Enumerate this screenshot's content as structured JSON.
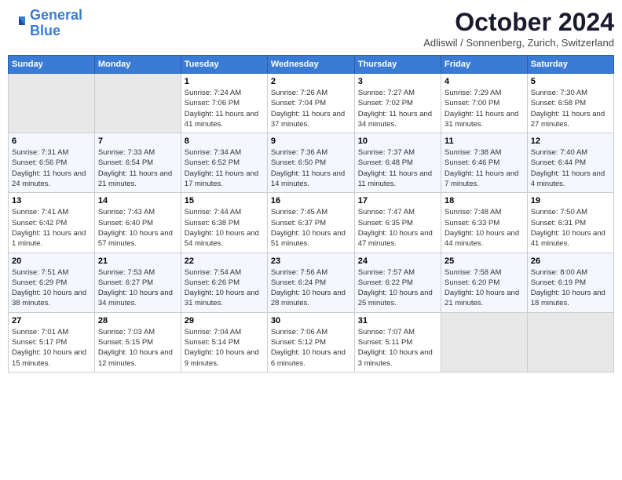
{
  "header": {
    "logo_line1": "General",
    "logo_line2": "Blue",
    "month_title": "October 2024",
    "subtitle": "Adliswil / Sonnenberg, Zurich, Switzerland"
  },
  "weekdays": [
    "Sunday",
    "Monday",
    "Tuesday",
    "Wednesday",
    "Thursday",
    "Friday",
    "Saturday"
  ],
  "weeks": [
    [
      {
        "day": "",
        "sunrise": "",
        "sunset": "",
        "daylight": ""
      },
      {
        "day": "",
        "sunrise": "",
        "sunset": "",
        "daylight": ""
      },
      {
        "day": "1",
        "sunrise": "Sunrise: 7:24 AM",
        "sunset": "Sunset: 7:06 PM",
        "daylight": "Daylight: 11 hours and 41 minutes."
      },
      {
        "day": "2",
        "sunrise": "Sunrise: 7:26 AM",
        "sunset": "Sunset: 7:04 PM",
        "daylight": "Daylight: 11 hours and 37 minutes."
      },
      {
        "day": "3",
        "sunrise": "Sunrise: 7:27 AM",
        "sunset": "Sunset: 7:02 PM",
        "daylight": "Daylight: 11 hours and 34 minutes."
      },
      {
        "day": "4",
        "sunrise": "Sunrise: 7:29 AM",
        "sunset": "Sunset: 7:00 PM",
        "daylight": "Daylight: 11 hours and 31 minutes."
      },
      {
        "day": "5",
        "sunrise": "Sunrise: 7:30 AM",
        "sunset": "Sunset: 6:58 PM",
        "daylight": "Daylight: 11 hours and 27 minutes."
      }
    ],
    [
      {
        "day": "6",
        "sunrise": "Sunrise: 7:31 AM",
        "sunset": "Sunset: 6:56 PM",
        "daylight": "Daylight: 11 hours and 24 minutes."
      },
      {
        "day": "7",
        "sunrise": "Sunrise: 7:33 AM",
        "sunset": "Sunset: 6:54 PM",
        "daylight": "Daylight: 11 hours and 21 minutes."
      },
      {
        "day": "8",
        "sunrise": "Sunrise: 7:34 AM",
        "sunset": "Sunset: 6:52 PM",
        "daylight": "Daylight: 11 hours and 17 minutes."
      },
      {
        "day": "9",
        "sunrise": "Sunrise: 7:36 AM",
        "sunset": "Sunset: 6:50 PM",
        "daylight": "Daylight: 11 hours and 14 minutes."
      },
      {
        "day": "10",
        "sunrise": "Sunrise: 7:37 AM",
        "sunset": "Sunset: 6:48 PM",
        "daylight": "Daylight: 11 hours and 11 minutes."
      },
      {
        "day": "11",
        "sunrise": "Sunrise: 7:38 AM",
        "sunset": "Sunset: 6:46 PM",
        "daylight": "Daylight: 11 hours and 7 minutes."
      },
      {
        "day": "12",
        "sunrise": "Sunrise: 7:40 AM",
        "sunset": "Sunset: 6:44 PM",
        "daylight": "Daylight: 11 hours and 4 minutes."
      }
    ],
    [
      {
        "day": "13",
        "sunrise": "Sunrise: 7:41 AM",
        "sunset": "Sunset: 6:42 PM",
        "daylight": "Daylight: 11 hours and 1 minute."
      },
      {
        "day": "14",
        "sunrise": "Sunrise: 7:43 AM",
        "sunset": "Sunset: 6:40 PM",
        "daylight": "Daylight: 10 hours and 57 minutes."
      },
      {
        "day": "15",
        "sunrise": "Sunrise: 7:44 AM",
        "sunset": "Sunset: 6:38 PM",
        "daylight": "Daylight: 10 hours and 54 minutes."
      },
      {
        "day": "16",
        "sunrise": "Sunrise: 7:45 AM",
        "sunset": "Sunset: 6:37 PM",
        "daylight": "Daylight: 10 hours and 51 minutes."
      },
      {
        "day": "17",
        "sunrise": "Sunrise: 7:47 AM",
        "sunset": "Sunset: 6:35 PM",
        "daylight": "Daylight: 10 hours and 47 minutes."
      },
      {
        "day": "18",
        "sunrise": "Sunrise: 7:48 AM",
        "sunset": "Sunset: 6:33 PM",
        "daylight": "Daylight: 10 hours and 44 minutes."
      },
      {
        "day": "19",
        "sunrise": "Sunrise: 7:50 AM",
        "sunset": "Sunset: 6:31 PM",
        "daylight": "Daylight: 10 hours and 41 minutes."
      }
    ],
    [
      {
        "day": "20",
        "sunrise": "Sunrise: 7:51 AM",
        "sunset": "Sunset: 6:29 PM",
        "daylight": "Daylight: 10 hours and 38 minutes."
      },
      {
        "day": "21",
        "sunrise": "Sunrise: 7:53 AM",
        "sunset": "Sunset: 6:27 PM",
        "daylight": "Daylight: 10 hours and 34 minutes."
      },
      {
        "day": "22",
        "sunrise": "Sunrise: 7:54 AM",
        "sunset": "Sunset: 6:26 PM",
        "daylight": "Daylight: 10 hours and 31 minutes."
      },
      {
        "day": "23",
        "sunrise": "Sunrise: 7:56 AM",
        "sunset": "Sunset: 6:24 PM",
        "daylight": "Daylight: 10 hours and 28 minutes."
      },
      {
        "day": "24",
        "sunrise": "Sunrise: 7:57 AM",
        "sunset": "Sunset: 6:22 PM",
        "daylight": "Daylight: 10 hours and 25 minutes."
      },
      {
        "day": "25",
        "sunrise": "Sunrise: 7:58 AM",
        "sunset": "Sunset: 6:20 PM",
        "daylight": "Daylight: 10 hours and 21 minutes."
      },
      {
        "day": "26",
        "sunrise": "Sunrise: 8:00 AM",
        "sunset": "Sunset: 6:19 PM",
        "daylight": "Daylight: 10 hours and 18 minutes."
      }
    ],
    [
      {
        "day": "27",
        "sunrise": "Sunrise: 7:01 AM",
        "sunset": "Sunset: 5:17 PM",
        "daylight": "Daylight: 10 hours and 15 minutes."
      },
      {
        "day": "28",
        "sunrise": "Sunrise: 7:03 AM",
        "sunset": "Sunset: 5:15 PM",
        "daylight": "Daylight: 10 hours and 12 minutes."
      },
      {
        "day": "29",
        "sunrise": "Sunrise: 7:04 AM",
        "sunset": "Sunset: 5:14 PM",
        "daylight": "Daylight: 10 hours and 9 minutes."
      },
      {
        "day": "30",
        "sunrise": "Sunrise: 7:06 AM",
        "sunset": "Sunset: 5:12 PM",
        "daylight": "Daylight: 10 hours and 6 minutes."
      },
      {
        "day": "31",
        "sunrise": "Sunrise: 7:07 AM",
        "sunset": "Sunset: 5:11 PM",
        "daylight": "Daylight: 10 hours and 3 minutes."
      },
      {
        "day": "",
        "sunrise": "",
        "sunset": "",
        "daylight": ""
      },
      {
        "day": "",
        "sunrise": "",
        "sunset": "",
        "daylight": ""
      }
    ]
  ]
}
